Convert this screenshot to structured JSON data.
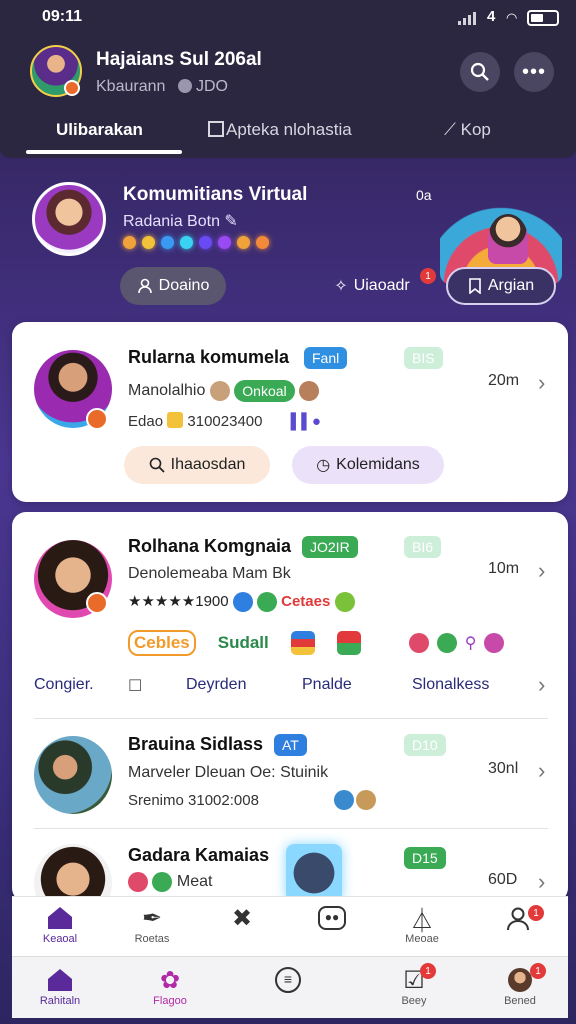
{
  "status": {
    "time": "09:11",
    "network": "4"
  },
  "header": {
    "title": "Hajaians Sul 206al",
    "subtitle": "Kbaurann",
    "subtitle2": "JDO"
  },
  "tabs": [
    {
      "label": "Ulibarakan"
    },
    {
      "label": "Apteka nlohastia"
    },
    {
      "label": "Kop"
    }
  ],
  "hero": {
    "title": "Komumitians Virtual",
    "subtitle": "Radania Botn",
    "time": "0a",
    "follow_label": "Doaino",
    "action_label": "Uiaoadr",
    "action_badge": "1",
    "join_label": "Argian"
  },
  "cards": [
    {
      "name": "Rularna komumela",
      "tag": "Fanl",
      "tag2": "BIS",
      "line1": "Manolalhio",
      "line1_tag": "Onkoal",
      "line2": "Edao",
      "line2_num": "310023400",
      "time": "20m",
      "btn1": "Ihaaosdan",
      "btn2": "Kolemidans"
    },
    {
      "name": "Rolhana Komgnaia",
      "tag": "JO2IR",
      "tag2": "BI6",
      "line1": "Denolemeaba Mam Bk",
      "rating": "★★★★★1900",
      "rating_tag": "Cetaes",
      "time": "10m",
      "chips": [
        "Cebles",
        "Sudall"
      ],
      "links": [
        "Congier.",
        "Deyrden",
        "Pnalde",
        "Slonalkess"
      ]
    },
    {
      "name": "Brauina Sidlass",
      "tag": "AT",
      "tag2": "D10",
      "line1": "Marveler Dleuan Oe: Stuinik",
      "line2": "Srenimo 31002:008",
      "time": "30nl"
    },
    {
      "name": "Gadara Kamaias",
      "tag2": "D15",
      "line1": "Meat",
      "time": "60D"
    }
  ],
  "subnav": [
    {
      "label": "Keaoal",
      "icon": "home-icon"
    },
    {
      "label": "Roetas",
      "icon": "feather-icon"
    },
    {
      "label": "",
      "icon": "tools-icon"
    },
    {
      "label": "",
      "icon": "game-icon"
    },
    {
      "label": "Meoae",
      "icon": "flask-icon"
    },
    {
      "label": "",
      "icon": "profile-icon",
      "badge": "1"
    }
  ],
  "mainnav": [
    {
      "label": "Rahitaln",
      "icon": "home-icon"
    },
    {
      "label": "Flagoo",
      "icon": "flower-icon"
    },
    {
      "label": "",
      "icon": "list-icon"
    },
    {
      "label": "Beey",
      "icon": "check-icon",
      "badge": "1"
    },
    {
      "label": "Bened",
      "icon": "avatar-icon",
      "badge": "1"
    }
  ],
  "colors": {
    "accent": "#5a2a9a",
    "badge": "#e23a3a",
    "green": "#3aaa55",
    "blue": "#2f7fe0"
  }
}
